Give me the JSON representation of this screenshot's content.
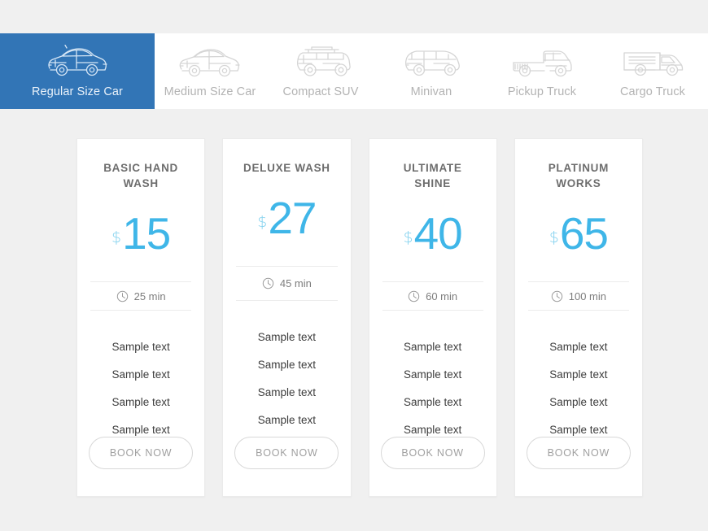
{
  "theme": {
    "page_background": "#f0f0f0",
    "active_tab_color": "#3275b6",
    "price_color": "#3fb6e8",
    "currency_color": "#7fd0ee",
    "card_background": "#ffffff",
    "muted_text": "#b3b3b3"
  },
  "tabs": [
    {
      "label": "Regular Size Car",
      "icon": "regular-size-car-icon",
      "active": true
    },
    {
      "label": "Medium Size Car",
      "icon": "medium-size-car-icon",
      "active": false
    },
    {
      "label": "Compact SUV",
      "icon": "compact-suv-icon",
      "active": false
    },
    {
      "label": "Minivan",
      "icon": "minivan-icon",
      "active": false
    },
    {
      "label": "Pickup Truck",
      "icon": "pickup-truck-icon",
      "active": false
    },
    {
      "label": "Cargo Truck",
      "icon": "cargo-truck-icon",
      "active": false
    }
  ],
  "plans": [
    {
      "title": "BASIC HAND WASH",
      "currency": "$",
      "price": "15",
      "duration": "25 min",
      "duration_icon": "clock-icon",
      "features": [
        "Sample text",
        "Sample text",
        "Sample text",
        "Sample text"
      ],
      "cta": "BOOK NOW"
    },
    {
      "title": "DELUXE WASH",
      "currency": "$",
      "price": "27",
      "duration": "45 min",
      "duration_icon": "clock-icon",
      "features": [
        "Sample text",
        "Sample text",
        "Sample text",
        "Sample text"
      ],
      "cta": "BOOK NOW"
    },
    {
      "title": "ULTIMATE SHINE",
      "currency": "$",
      "price": "40",
      "duration": "60 min",
      "duration_icon": "clock-icon",
      "features": [
        "Sample text",
        "Sample text",
        "Sample text",
        "Sample text"
      ],
      "cta": "BOOK NOW"
    },
    {
      "title": "PLATINUM WORKS",
      "currency": "$",
      "price": "65",
      "duration": "100 min",
      "duration_icon": "clock-icon",
      "features": [
        "Sample text",
        "Sample text",
        "Sample text",
        "Sample text"
      ],
      "cta": "BOOK NOW"
    }
  ]
}
